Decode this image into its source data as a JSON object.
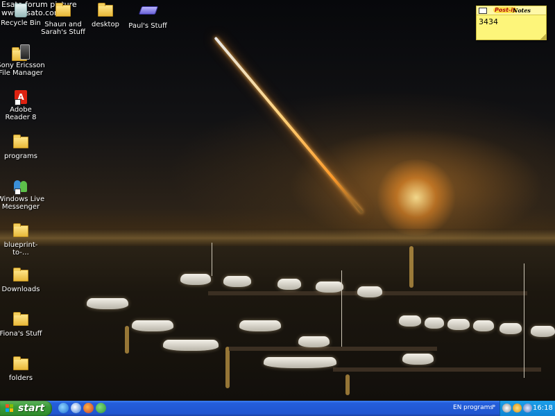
{
  "header": {
    "caption_line1": "Esato forum picture",
    "caption_line2": "www.esato.com"
  },
  "desktop": {
    "icons": [
      {
        "label": "Recycle Bin",
        "icon": "recycle-bin-icon"
      },
      {
        "label": "Shaun and Sarah's Stuff",
        "icon": "folder-icon"
      },
      {
        "label": "desktop",
        "icon": "folder-icon"
      },
      {
        "label": "Paul's Stuff",
        "icon": "drive-icon"
      },
      {
        "label": "Sony Ericsson File Manager",
        "icon": "phone-icon"
      },
      {
        "label": "Adobe Reader 8",
        "icon": "pdf-icon"
      },
      {
        "label": "programs",
        "icon": "folder-icon"
      },
      {
        "label": "Windows Live Messenger",
        "icon": "messenger-icon"
      },
      {
        "label": "blueprint-to-…",
        "icon": "folder-icon"
      },
      {
        "label": "Downloads",
        "icon": "folder-icon"
      },
      {
        "label": "Fiona's Stuff",
        "icon": "folder-icon"
      },
      {
        "label": "folders",
        "icon": "folder-icon"
      }
    ]
  },
  "sticky_note": {
    "brand": "Post-it",
    "title": "Notes",
    "text": "3434",
    "color": "#fdf57a"
  },
  "taskbar": {
    "start_label": "start",
    "quick_launch": [
      "internet-explorer-icon",
      "media-player-icon",
      "firefox-icon",
      "messenger-icon"
    ],
    "language": "EN",
    "toolbar_label": "programs",
    "tray_chevron": "»",
    "clock": "16:18",
    "colors": {
      "taskbar": "#245edb",
      "start": "#3a9a37",
      "tray": "#0e84d4"
    }
  }
}
